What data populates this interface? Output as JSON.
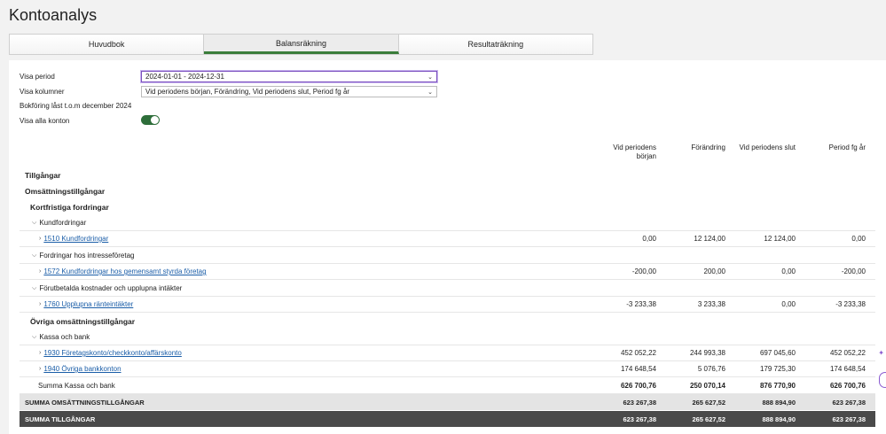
{
  "page": {
    "title": "Kontoanalys"
  },
  "tabs": [
    {
      "label": "Huvudbok"
    },
    {
      "label": "Balansräkning"
    },
    {
      "label": "Resultaträkning"
    }
  ],
  "form": {
    "period_label": "Visa period",
    "period_value": "2024-01-01 - 2024-12-31",
    "columns_label": "Visa kolumner",
    "columns_value": "Vid periodens början, Förändring, Vid periodens slut, Period fg år",
    "locked_text": "Bokföring låst t.o.m december 2024",
    "show_all_label": "Visa alla konton",
    "show_all_on": true
  },
  "columns": {
    "c1_line1": "Vid periodens",
    "c1_line2": "början",
    "c2": "Förändring",
    "c3": "Vid periodens slut",
    "c4": "Period fg år"
  },
  "rows": {
    "tillgangar": "Tillgångar",
    "omsattning": "Omsättningstillgångar",
    "kortfristiga": "Kortfristiga fordringar",
    "kundfordringar_grp": "Kundfordringar",
    "acc1510": {
      "label": "1510 Kundfordringar",
      "v1": "0,00",
      "v2": "12 124,00",
      "v3": "12 124,00",
      "v4": "0,00"
    },
    "intresse_grp": "Fordringar hos intresseföretag",
    "acc1572": {
      "label": "1572 Kundfordringar hos gemensamt styrda företag",
      "v1": "-200,00",
      "v2": "200,00",
      "v3": "0,00",
      "v4": "-200,00"
    },
    "forutbetalda_grp": "Förutbetalda kostnader och upplupna intäkter",
    "acc1760": {
      "label": "1760 Upplupna ränteintäkter",
      "v1": "-3 233,38",
      "v2": "3 233,38",
      "v3": "0,00",
      "v4": "-3 233,38"
    },
    "ovriga": "Övriga omsättningstillgångar",
    "kassa_grp": "Kassa och bank",
    "acc1930": {
      "label": "1930 Företagskonto/checkkonto/affärskonto",
      "v1": "452 052,22",
      "v2": "244 993,38",
      "v3": "697 045,60",
      "v4": "452 052,22"
    },
    "acc1940": {
      "label": "1940 Övriga bankkonton",
      "v1": "174 648,54",
      "v2": "5 076,76",
      "v3": "179 725,30",
      "v4": "174 648,54"
    },
    "summa_kassa": {
      "label": "Summa Kassa och bank",
      "v1": "626 700,76",
      "v2": "250 070,14",
      "v3": "876 770,90",
      "v4": "626 700,76"
    },
    "summa_oms": {
      "label": "SUMMA OMSÄTTNINGSTILLGÅNGAR",
      "v1": "623 267,38",
      "v2": "265 627,52",
      "v3": "888 894,90",
      "v4": "623 267,38"
    },
    "summa_tillg": {
      "label": "SUMMA TILLGÅNGAR",
      "v1": "623 267,38",
      "v2": "265 627,52",
      "v3": "888 894,90",
      "v4": "623 267,38"
    }
  }
}
